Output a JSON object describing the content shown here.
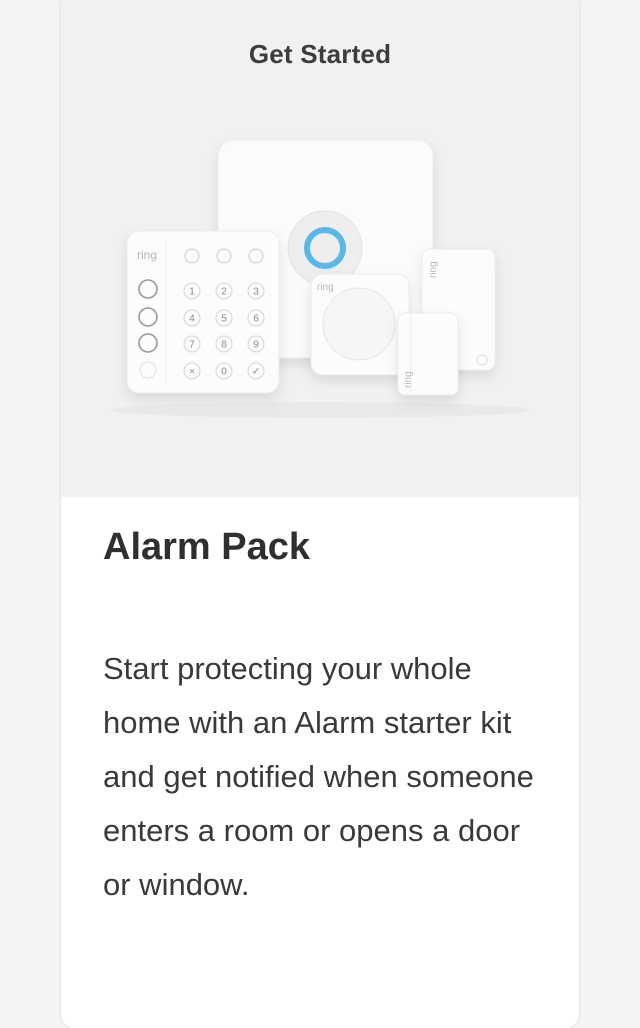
{
  "header": {
    "title": "Get Started"
  },
  "product": {
    "name": "Alarm Pack",
    "description": "Start protecting your whole home with an Alarm starter kit and get notified when someone enters a room or opens a door or window.",
    "brand": "ring"
  },
  "keypad": {
    "keys": [
      "1",
      "2",
      "3",
      "4",
      "5",
      "6",
      "7",
      "8",
      "9",
      "×",
      "0",
      "✓"
    ]
  },
  "colors": {
    "accent_ring": "#5ab8e6",
    "hero_bg": "#f1f1f1"
  }
}
